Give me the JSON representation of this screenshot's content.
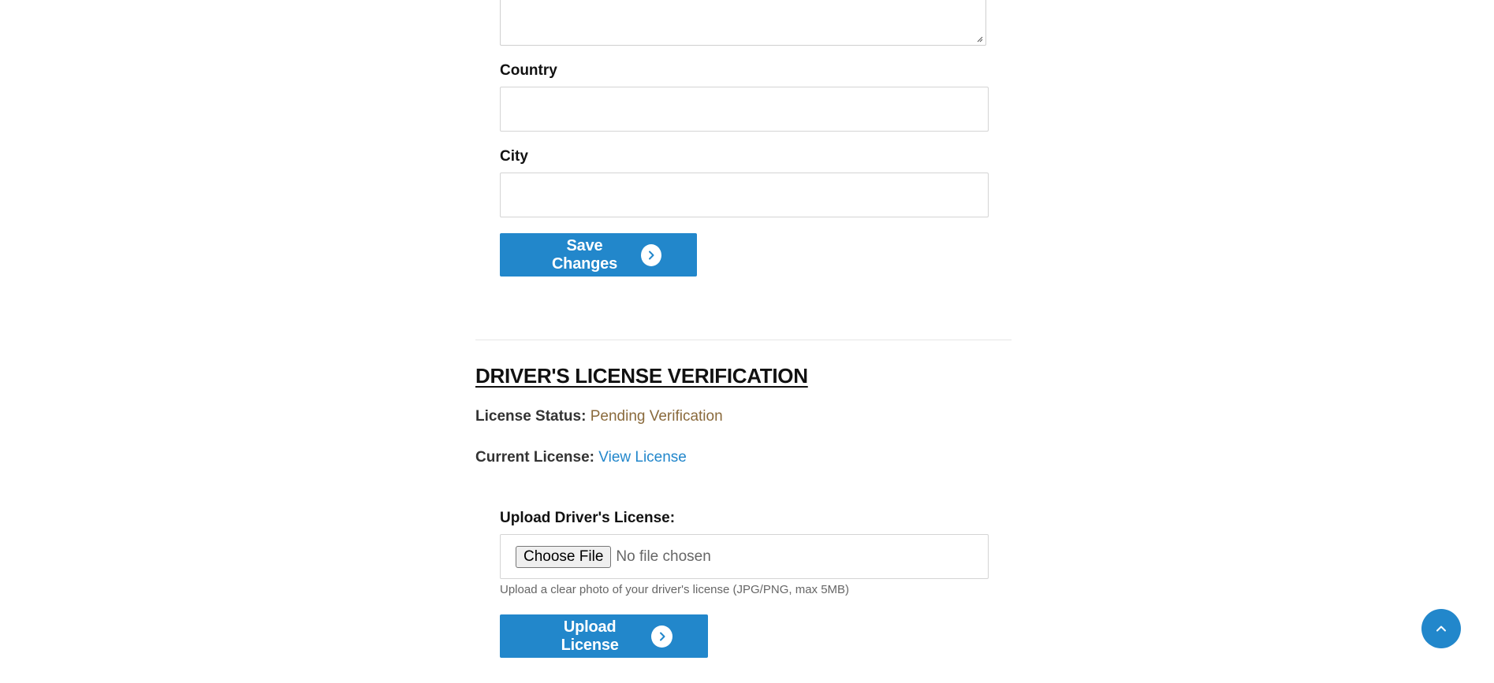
{
  "profile_form": {
    "country_label": "Country",
    "country_value": "",
    "city_label": "City",
    "city_value": "",
    "save_button_label": "Save Changes"
  },
  "license_section": {
    "title": "DRIVER'S LICENSE VERIFICATION",
    "status_label": "License Status:",
    "status_value": "Pending Verification",
    "current_label": "Current License:",
    "current_link": "View License",
    "upload_label": "Upload Driver's License:",
    "choose_file_label": "Choose File",
    "no_file_text": "No file chosen",
    "help_text": "Upload a clear photo of your driver's license (JPG/PNG, max 5MB)",
    "upload_button_label": "Upload License"
  },
  "colors": {
    "primary": "#2287cb",
    "status_pending": "#8a6a3c"
  },
  "icons": {
    "button_arrow": "chevron-right-icon",
    "scroll_top": "chevron-up-icon"
  }
}
